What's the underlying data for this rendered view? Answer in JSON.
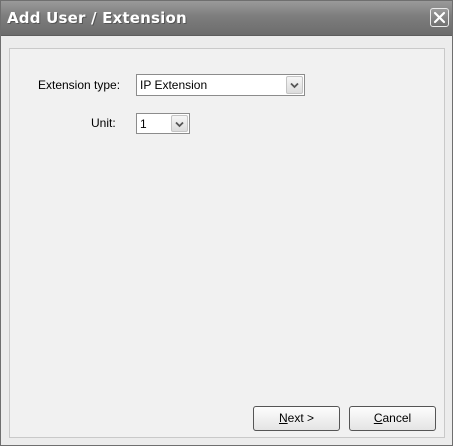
{
  "window": {
    "title": "Add User / Extension"
  },
  "form": {
    "extension_type_label": "Extension type:",
    "extension_type_value": "IP Extension",
    "unit_label": "Unit:",
    "unit_value": "1"
  },
  "buttons": {
    "next_mnemonic": "N",
    "next_rest": "ext >",
    "cancel_mnemonic": "C",
    "cancel_rest": "ancel"
  },
  "icons": {
    "close": "close-icon",
    "dropdown": "chevron-down-icon"
  }
}
